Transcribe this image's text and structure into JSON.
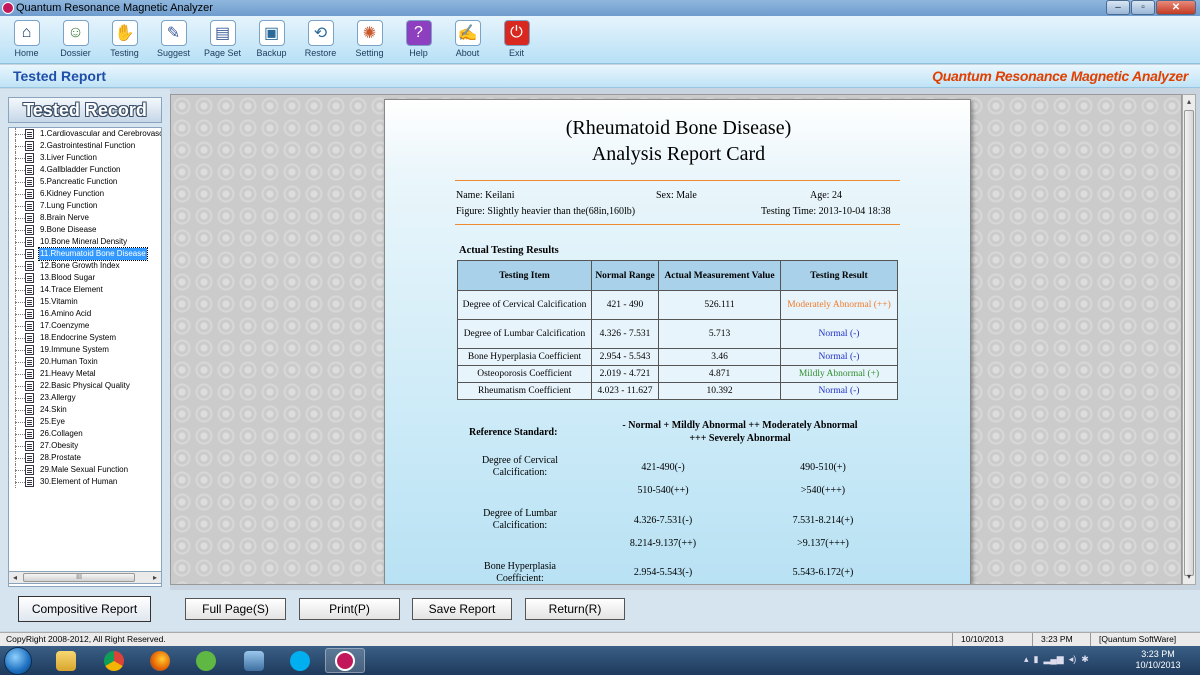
{
  "window": {
    "title": "Quantum Resonance Magnetic Analyzer"
  },
  "toolbar": [
    {
      "label": "Home",
      "icon": "home-icon"
    },
    {
      "label": "Dossier",
      "icon": "users-icon"
    },
    {
      "label": "Testing",
      "icon": "hand-icon"
    },
    {
      "label": "Suggest",
      "icon": "suggest-icon"
    },
    {
      "label": "Page Set",
      "icon": "page-set-icon"
    },
    {
      "label": "Backup",
      "icon": "backup-icon"
    },
    {
      "label": "Restore",
      "icon": "restore-icon"
    },
    {
      "label": "Setting",
      "icon": "gears-icon"
    },
    {
      "label": "Help",
      "icon": "help-icon"
    },
    {
      "label": "About",
      "icon": "about-icon"
    },
    {
      "label": "Exit",
      "icon": "power-icon"
    }
  ],
  "header": {
    "title": "Tested Report",
    "brand": "Quantum Resonance Magnetic Analyzer"
  },
  "sidebar": {
    "title": "Tested Record",
    "items": [
      "1.Cardiovascular and Cerebrovasc",
      "2.Gastrointestinal Function",
      "3.Liver Function",
      "4.Gallbladder Function",
      "5.Pancreatic Function",
      "6.Kidney Function",
      "7.Lung Function",
      "8.Brain Nerve",
      "9.Bone Disease",
      "10.Bone Mineral Density",
      "11.Rheumatoid Bone Disease",
      "12.Bone Growth Index",
      "13.Blood Sugar",
      "14.Trace Element",
      "15.Vitamin",
      "16.Amino Acid",
      "17.Coenzyme",
      "18.Endocrine System",
      "19.Immune System",
      "20.Human Toxin",
      "21.Heavy Metal",
      "22.Basic Physical Quality",
      "23.Allergy",
      "24.Skin",
      "25.Eye",
      "26.Collagen",
      "27.Obesity",
      "28.Prostate",
      "29.Male Sexual Function",
      "30.Element of Human"
    ],
    "selected_index": 10,
    "scroll_thumb_label": "III",
    "compositive_label": "Compositive Report"
  },
  "report": {
    "title_line1": "(Rheumatoid Bone Disease)",
    "title_line2": "Analysis Report Card",
    "name": "Name: Keilani",
    "sex": "Sex: Male",
    "age": "Age: 24",
    "figure": "Figure: Slightly heavier than the(68in,160lb)",
    "testing_time": "Testing Time: 2013-10-04 18:38",
    "results_heading": "Actual Testing Results",
    "columns": [
      "Testing Item",
      "Normal Range",
      "Actual Measurement Value",
      "Testing Result"
    ],
    "rows": [
      {
        "item": "Degree of Cervical Calcification",
        "range": "421 - 490",
        "value": "526.111",
        "result": "Moderately Abnormal (++)",
        "level": "mod"
      },
      {
        "item": "Degree of Lumbar Calcification",
        "range": "4.326 - 7.531",
        "value": "5.713",
        "result": "Normal (-)",
        "level": "normal"
      },
      {
        "item": "Bone Hyperplasia Coefficient",
        "range": "2.954 - 5.543",
        "value": "3.46",
        "result": "Normal (-)",
        "level": "normal"
      },
      {
        "item": "Osteoporosis Coefficient",
        "range": "2.019 - 4.721",
        "value": "4.871",
        "result": "Mildly Abnormal (+)",
        "level": "mild"
      },
      {
        "item": "Rheumatism Coefficient",
        "range": "4.023 - 11.627",
        "value": "10.392",
        "result": "Normal (-)",
        "level": "normal"
      }
    ],
    "reference": {
      "label": "Reference Standard:",
      "legend_line1": "- Normal   + Mildly Abnormal   ++ Moderately Abnormal",
      "legend_line2": "+++ Severely Abnormal",
      "items": [
        {
          "name_line1": "Degree of Cervical",
          "name_line2": "Calcification:",
          "v1": "421-490(-)",
          "v2": "490-510(+)",
          "v3": "510-540(++)",
          "v4": ">540(+++)"
        },
        {
          "name_line1": "Degree of Lumbar",
          "name_line2": "Calcification:",
          "v1": "4.326-7.531(-)",
          "v2": "7.531-8.214(+)",
          "v3": "8.214-9.137(++)",
          "v4": ">9.137(+++)"
        },
        {
          "name_line1": "Bone Hyperplasia",
          "name_line2": "Coefficient:",
          "v1": "2.954-5.543(-)",
          "v2": "5.543-6.172(+)"
        }
      ]
    }
  },
  "buttons": {
    "full_page": "Full Page(S)",
    "print": "Print(P)",
    "save": "Save Report",
    "return": "Return(R)"
  },
  "status": {
    "copyright": "CopyRight 2008-2012, All Right Reserved.",
    "date": "10/10/2013",
    "time": "3:23 PM",
    "vendor": "[Quantum SoftWare]"
  },
  "taskbar": {
    "time": "3:23 PM",
    "date": "10/10/2013"
  }
}
